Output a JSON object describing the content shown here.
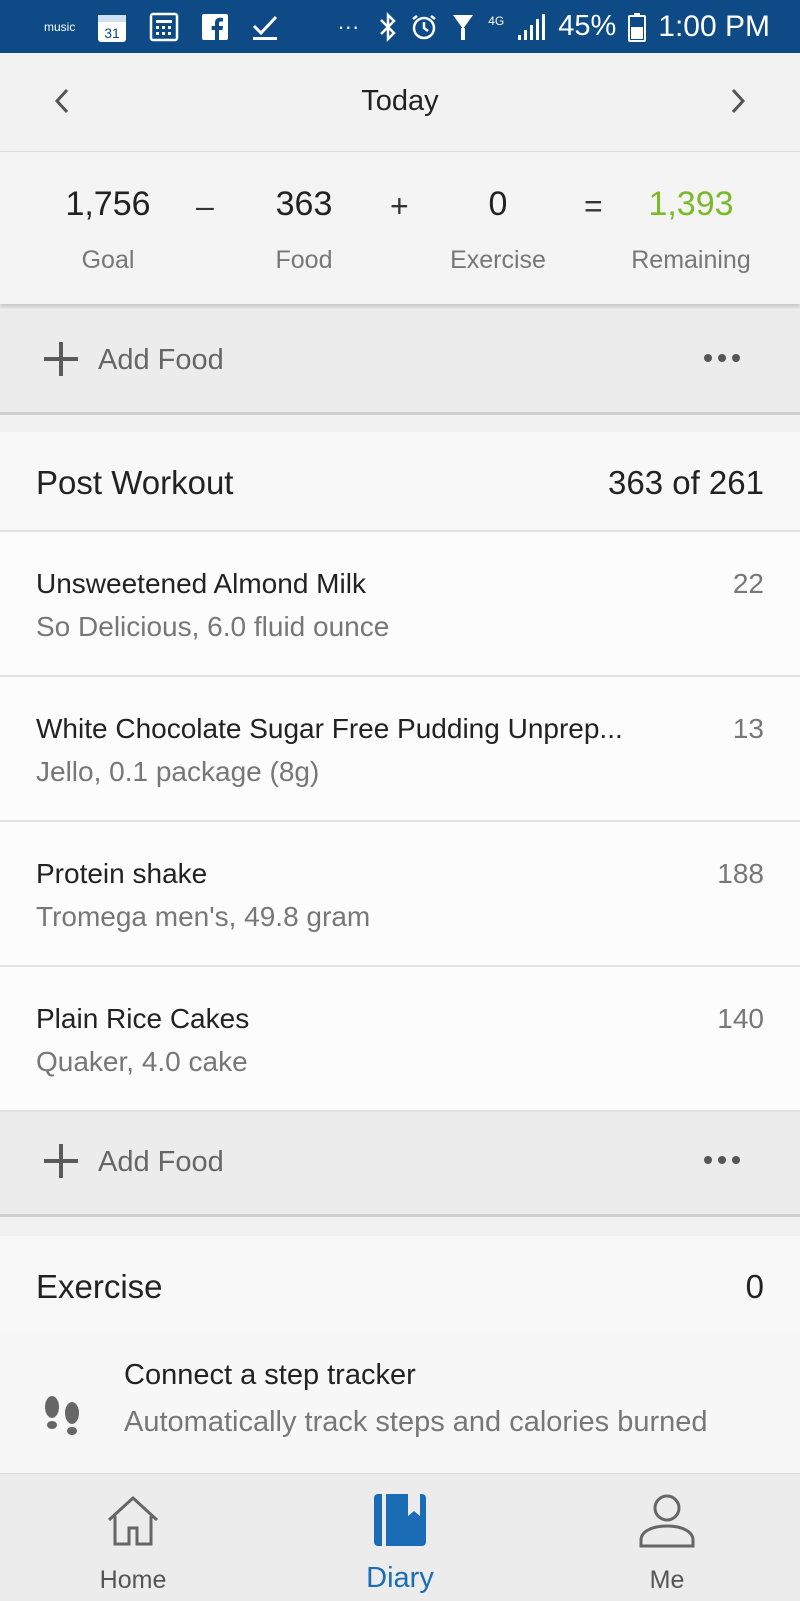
{
  "status_bar": {
    "left_icons": [
      "music-icon",
      "calendar-icon",
      "calculator-icon",
      "facebook-icon",
      "check-icon",
      "more-icon"
    ],
    "music_label": "music",
    "calendar_day": "31",
    "dots": "···",
    "network": "4G",
    "battery": "45%",
    "time": "1:00 PM"
  },
  "date_nav": {
    "title": "Today"
  },
  "summary": {
    "goal_value": "1,756",
    "goal_label": "Goal",
    "minus": "–",
    "food_value": "363",
    "food_label": "Food",
    "plus": "+",
    "exercise_value": "0",
    "exercise_label": "Exercise",
    "equals": "=",
    "remaining_value": "1,393",
    "remaining_label": "Remaining",
    "remaining_color": "#7bb928"
  },
  "add_food_label": "Add Food",
  "post_workout": {
    "title": "Post Workout",
    "value": "363 of 261",
    "items": [
      {
        "name": "Unsweetened Almond Milk",
        "desc": "So Delicious, 6.0 fluid ounce",
        "cal": "22"
      },
      {
        "name": "White Chocolate Sugar Free Pudding Unprep...",
        "desc": "Jello, 0.1 package (8g)",
        "cal": "13"
      },
      {
        "name": "Protein shake",
        "desc": "Tromega  men's, 49.8 gram",
        "cal": "188"
      },
      {
        "name": "Plain Rice Cakes",
        "desc": "Quaker, 4.0 cake",
        "cal": "140"
      }
    ]
  },
  "exercise": {
    "title": "Exercise",
    "value": "0"
  },
  "tracker": {
    "title": "Connect a step tracker",
    "desc": "Automatically track steps and calories burned"
  },
  "bottom_nav": {
    "home": "Home",
    "diary": "Diary",
    "me": "Me",
    "active_color": "#1a6db5"
  }
}
